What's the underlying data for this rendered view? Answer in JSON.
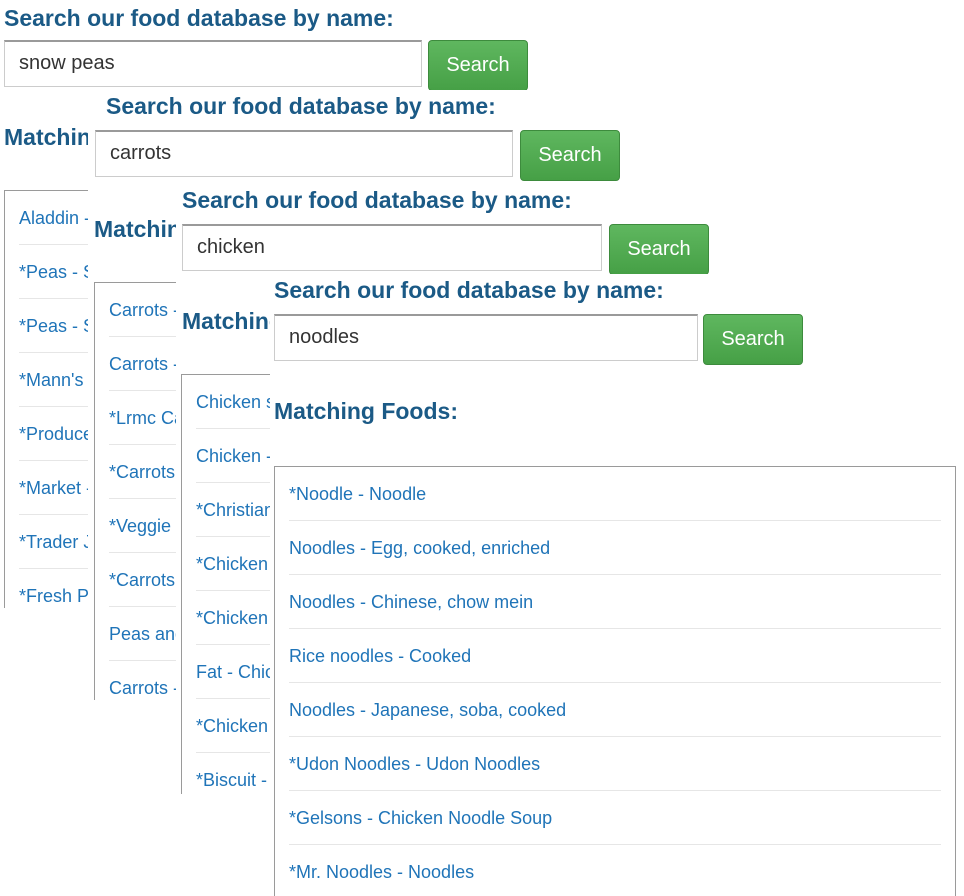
{
  "colors": {
    "heading": "#1b5a86",
    "link": "#1f74b8",
    "button": "#4cae4c"
  },
  "panels": [
    {
      "heading": "Search our food database by name:",
      "query": "snow peas",
      "button": "Search",
      "matching": "Matching Foods:",
      "results": [
        "Aladdin - Snow Peas",
        "*Peas - Snow Peas",
        "*Peas - Snow peas",
        "*Mann's - Snow Peas",
        "*Produce - Snow Peas",
        "*Market - Snow Peas",
        "*Trader Joe's - Snow Peas",
        "*Fresh Produce - Snow Peas"
      ]
    },
    {
      "heading": "Search our food database by name:",
      "query": "carrots",
      "button": "Search",
      "matching": "Matching Foods:",
      "results": [
        "Carrots - Raw",
        "Carrots - Cooked",
        "*Lrmc Carrots",
        "*Carrots",
        "*Veggie Carrots",
        "*Carrots - Baby",
        "Peas and Carrots",
        "Carrots - Canned"
      ]
    },
    {
      "heading": "Search our food database by name:",
      "query": "chicken",
      "button": "Search",
      "matching": "Matching Foods:",
      "results": [
        "Chicken soup",
        "Chicken - Breast",
        "*Christian - Chicken",
        "*Chicken Breast",
        "*Chicken Thigh",
        "Fat - Chicken",
        "*Chicken Wings",
        "*Biscuit - Chicken"
      ]
    },
    {
      "heading": "Search our food database by name:",
      "query": "noodles",
      "button": "Search",
      "matching": "Matching Foods:",
      "results": [
        "*Noodle - Noodle",
        "Noodles - Egg, cooked, enriched",
        "Noodles - Chinese, chow mein",
        "Rice noodles - Cooked",
        "Noodles - Japanese, soba, cooked",
        "*Udon Noodles - Udon Noodles",
        "*Gelsons - Chicken Noodle Soup",
        "*Mr. Noodles - Noodles"
      ]
    }
  ]
}
